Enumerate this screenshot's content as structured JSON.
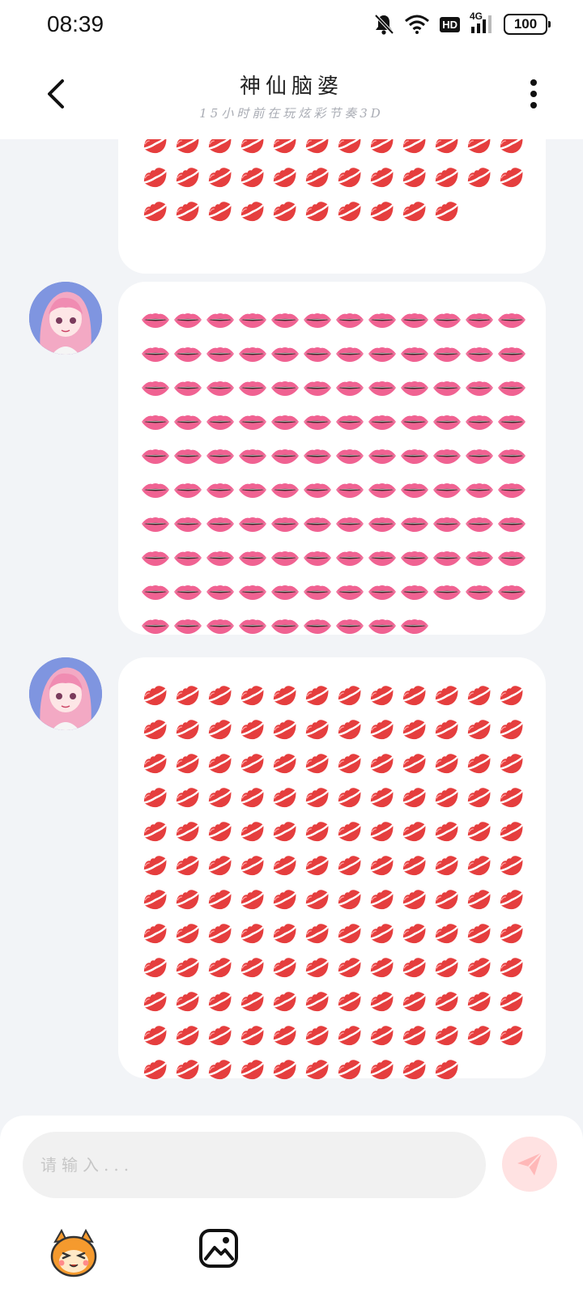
{
  "status_bar": {
    "time": "08:39",
    "network": "4G",
    "hd": "HD",
    "battery": "100",
    "icons": [
      "bell-off-icon",
      "wifi-icon",
      "hd-icon",
      "signal-icon",
      "battery-icon"
    ]
  },
  "header": {
    "title": "神仙脑婆",
    "subtitle": "15小时前在玩炫彩节奏3D",
    "back_icon": "chevron-left-icon",
    "more_icon": "more-vertical-icon"
  },
  "messages": [
    {
      "sender": "other",
      "emoji": "💋",
      "emoji_name": "kiss-mark",
      "count": 34,
      "show_avatar": false
    },
    {
      "sender": "other",
      "emoji": "👄",
      "emoji_name": "mouth",
      "count": 117,
      "show_avatar": true
    },
    {
      "sender": "other",
      "emoji": "💋",
      "emoji_name": "kiss-mark",
      "count": 142,
      "show_avatar": true
    }
  ],
  "composer": {
    "placeholder": "请输入...",
    "value": "",
    "send_icon": "send-icon",
    "emoji_picker_icon": "mascot-face-icon",
    "image_icon": "image-icon"
  },
  "colors": {
    "background": "#f2f4f7",
    "bubble": "#ffffff",
    "kiss": "#e53e3e",
    "lips": "#f06292",
    "send_disabled": "#ffe2e2",
    "send_arrow": "#ffb8b8"
  }
}
